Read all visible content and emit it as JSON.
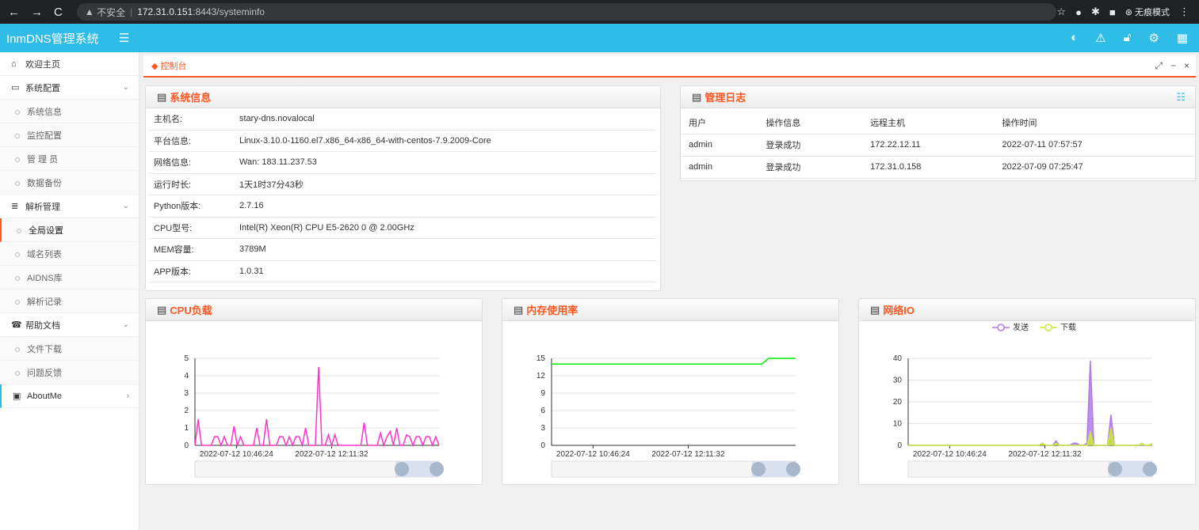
{
  "browser": {
    "security_label": "不安全",
    "host": "172.31.0.151",
    "path": ":8443/systeminfo",
    "incognito_label": "无痕模式"
  },
  "app": {
    "brand": "InmDNS管理系统",
    "accent": "#2fbde8",
    "highlight": "#ff5722"
  },
  "sidebar": {
    "home": "欢迎主页",
    "sys_config": "系统配置",
    "sys_config_items": [
      "系统信息",
      "监控配置",
      "管 理 员",
      "数据备份"
    ],
    "dns_manage": "解析管理",
    "dns_manage_items": [
      "全局设置",
      "域名列表",
      "AIDNS库",
      "解析记录"
    ],
    "help": "帮助文档",
    "help_items": [
      "文件下载",
      "问题反馈"
    ],
    "about": "AboutMe"
  },
  "tab": {
    "label": "控制台"
  },
  "sysinfo": {
    "title": "系统信息",
    "rows": [
      {
        "k": "主机名:",
        "v": "stary-dns.novalocal"
      },
      {
        "k": "平台信息:",
        "v": "Linux-3.10.0-1160.el7.x86_64-x86_64-with-centos-7.9.2009-Core"
      },
      {
        "k": "网络信息:",
        "v": "Wan: 183.11.237.53"
      },
      {
        "k": "运行时长:",
        "v": "1天1时37分43秒"
      },
      {
        "k": "Python版本:",
        "v": "2.7.16"
      },
      {
        "k": "CPU型号:",
        "v": "Intel(R) Xeon(R) CPU E5-2620 0 @ 2.00GHz"
      },
      {
        "k": "MEM容量:",
        "v": "3789M"
      },
      {
        "k": "APP版本:",
        "v": "1.0.31"
      }
    ]
  },
  "logs": {
    "title": "管理日志",
    "headers": [
      "用户",
      "操作信息",
      "远程主机",
      "操作时间"
    ],
    "rows": [
      [
        "admin",
        "登录成功",
        "172.22.12.11",
        "2022-07-11 07:57:57"
      ],
      [
        "admin",
        "登录成功",
        "172.31.0.158",
        "2022-07-09 07:25:47"
      ]
    ]
  },
  "chart_data": [
    {
      "type": "line",
      "title": "CPU负载",
      "color": "#ff33cc",
      "ylim": [
        0,
        5
      ],
      "yticks": [
        0,
        1,
        2,
        3,
        4,
        5
      ],
      "xticks": [
        "2022-07-12 10:46:24",
        "2022-07-12 12:11:32"
      ],
      "series": [
        {
          "values": [
            0,
            1.5,
            0,
            0,
            0,
            0,
            0.5,
            0.5,
            0,
            0.5,
            0,
            0,
            1.1,
            0,
            0.5,
            0,
            0,
            0,
            0,
            1,
            0,
            0,
            1.5,
            0,
            0,
            0,
            0.5,
            0.5,
            0,
            0.5,
            0,
            0.5,
            0.5,
            0,
            1,
            0,
            0,
            0,
            4.5,
            0,
            0,
            0.6,
            0,
            0.6,
            0,
            0,
            0,
            0,
            0,
            0,
            0,
            0,
            1.3,
            0,
            0,
            0,
            0,
            0.7,
            0,
            0.5,
            0.8,
            0,
            1,
            0,
            0,
            0.6,
            0.5,
            0,
            0.5,
            0.5,
            0,
            0.5,
            0.5,
            0,
            0.5,
            0
          ]
        }
      ]
    },
    {
      "type": "line",
      "title": "内存使用率",
      "color": "#00ee00",
      "ylim": [
        0,
        15
      ],
      "yticks": [
        0,
        3,
        6,
        9,
        12,
        15
      ],
      "xticks": [
        "2022-07-12 10:46:24",
        "2022-07-12 12:11:32"
      ],
      "series": [
        {
          "values": [
            14,
            14,
            14,
            14,
            14,
            14,
            14,
            14,
            14,
            14,
            14,
            14,
            14,
            14,
            14,
            14,
            14,
            14,
            14,
            14,
            14,
            14,
            14,
            14,
            14,
            14,
            14,
            14,
            14,
            14,
            14,
            14,
            15,
            15,
            15,
            15,
            15
          ]
        }
      ]
    },
    {
      "type": "area",
      "title": "网络IO",
      "ylim": [
        0,
        40
      ],
      "yticks": [
        0,
        10,
        20,
        30,
        40
      ],
      "xticks": [
        "2022-07-12 10:46:24",
        "2022-07-12 12:11:32"
      ],
      "series": [
        {
          "name": "发送",
          "color": "#b07ce8",
          "values": [
            0,
            0,
            0,
            0,
            0,
            0,
            0,
            0,
            0,
            0,
            0,
            0,
            0,
            0,
            0,
            0,
            0,
            0,
            0,
            0,
            0,
            0,
            0,
            0,
            0,
            0,
            0,
            0,
            0,
            0,
            0,
            0,
            0,
            0,
            0,
            0,
            0,
            0,
            0,
            1,
            0,
            0,
            0,
            2,
            0,
            0,
            0,
            0,
            1,
            1,
            0,
            0,
            1,
            39,
            0,
            0,
            0,
            0,
            0,
            14,
            0,
            0,
            0,
            0,
            0,
            0,
            0,
            0,
            0,
            0,
            0,
            0
          ]
        },
        {
          "name": "下载",
          "color": "#c8e83c",
          "values": [
            0,
            0,
            0,
            0,
            0,
            0,
            0,
            0,
            0,
            0,
            0,
            0,
            0,
            0,
            0,
            0,
            0,
            0,
            0,
            0,
            0,
            0,
            0,
            0,
            0,
            0,
            0,
            0,
            0,
            0,
            0,
            0,
            0,
            0,
            0,
            0,
            0,
            0,
            0,
            1,
            0,
            0,
            0,
            1,
            0,
            0,
            0,
            0,
            0,
            0,
            0,
            0,
            0,
            6,
            0,
            0,
            0,
            0,
            0,
            8,
            0,
            0,
            0,
            0,
            0,
            0,
            0,
            0,
            1,
            0,
            0,
            1
          ]
        }
      ]
    }
  ]
}
